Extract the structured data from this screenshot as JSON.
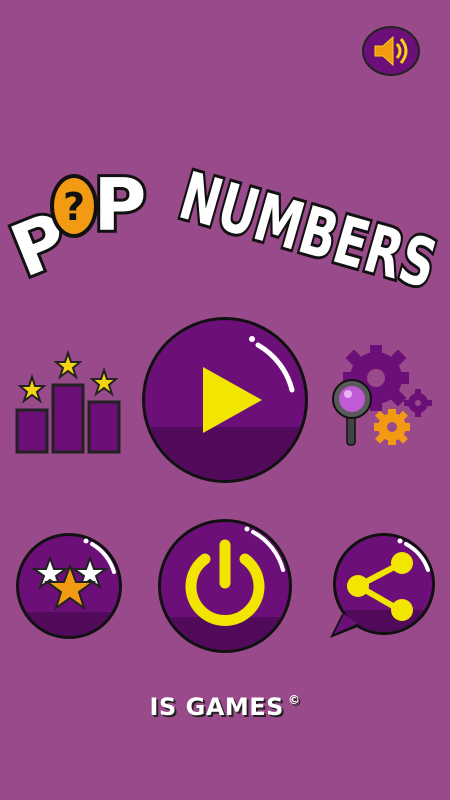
{
  "title": {
    "letter_p1": "P",
    "question_mark": "?",
    "letter_p2": "P",
    "word_numbers": "NUMBERS"
  },
  "footer": {
    "company": "IS GAMES",
    "copyright_symbol": "©"
  },
  "icons": {
    "sound": "speaker-icon",
    "leaderboard": "leaderboard-podium-icon",
    "play": "play-icon",
    "settings": "settings-gears-icon",
    "rate": "rate-stars-icon",
    "power": "power-icon",
    "share": "share-icon"
  },
  "colors": {
    "background": "#994a8a",
    "button_purple": "#6c0f78",
    "button_purple_dark": "#510b5a",
    "accent_yellow": "#f2e600",
    "bubble_orange": "#f39a14",
    "star_yellow": "#f5d214"
  }
}
